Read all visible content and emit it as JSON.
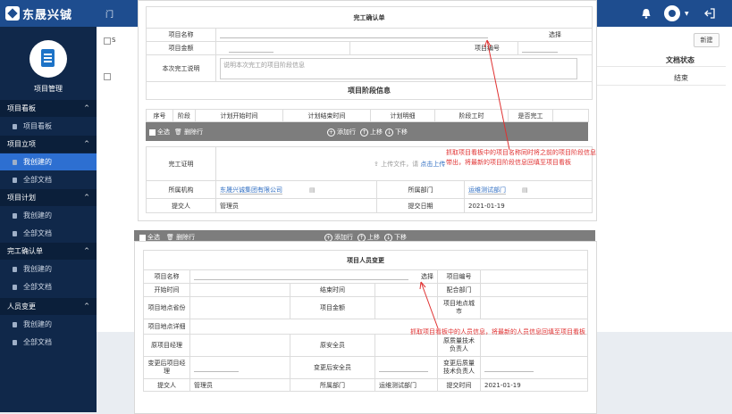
{
  "header": {
    "logo_text": "东晟兴铖",
    "left_fragment": "门",
    "icons": [
      "bell-icon",
      "user-avatar-icon",
      "logout-icon"
    ]
  },
  "sidebar": {
    "project_title": "项目管理",
    "sections": [
      {
        "label": "项目看板",
        "items": [
          "项目看板"
        ]
      },
      {
        "label": "项目立项",
        "items": [
          "我创建的",
          "全部文档"
        ]
      },
      {
        "label": "项目计划",
        "items": [
          "我创建的",
          "全部文档"
        ]
      },
      {
        "label": "完工确认单",
        "items": [
          "我创建的",
          "全部文档"
        ]
      },
      {
        "label": "人员变更",
        "items": [
          "我创建的",
          "全部文档"
        ]
      }
    ]
  },
  "list_bg": {
    "new_button": "新建",
    "col_status": "文档状态",
    "row_status": "结束",
    "left_fragment": "S"
  },
  "completion_form": {
    "title": "完工确认单",
    "project_name_label": "项目名称",
    "select_label": "选择",
    "project_amount_label": "项目金额",
    "project_number_label": "项目编号",
    "description_label": "本次完工说明",
    "description_placeholder": "说明本次完工的项目阶段信息",
    "stage_title": "项目阶段信息",
    "stage_columns": [
      "序号",
      "阶段",
      "计划开始时间",
      "计划结束时间",
      "计划明细",
      "阶段工时",
      "是否完工"
    ],
    "select_all": "全选",
    "delete_row": "删除行",
    "add_row": "添加行",
    "move_up": "上移",
    "move_down": "下移",
    "proof_label": "完工证明",
    "upload_text": "上传文件，请",
    "upload_link": "点击上传",
    "org_label": "所属机构",
    "org_value": "东晟兴诚集团有限公司",
    "dept_label": "所属部门",
    "dept_value": "运维测试部门",
    "submitter_label": "提交人",
    "submitter_value": "管理员",
    "submit_date_label": "提交日期",
    "submit_date_value": "2021-01-19"
  },
  "annotation1": [
    "抓取项目看板中的项目名称同时将之前的项目阶段信息",
    "带出，将最新的项目阶段信息回填至项目看板"
  ],
  "mid_toolbar": {
    "select_all": "全选",
    "delete_row": "删除行",
    "add_row": "添加行",
    "move_up": "上移",
    "move_down": "下移"
  },
  "staff_form": {
    "title": "项目人员变更",
    "project_name_label": "项目名称",
    "select_label": "选择",
    "project_number_label": "项目编号",
    "start_time_label": "开始时间",
    "end_time_label": "结束时间",
    "partner_dept_label": "配合部门",
    "province_label": "项目地点省份",
    "amount_label": "项目金额",
    "city_label": "项目地点城市",
    "address_label": "项目地点详细",
    "orig_manager_label": "原项目经理",
    "orig_safety_label": "原安全员",
    "orig_quality_label": "原质量技术负责人",
    "new_manager_label": "变更后项目经理",
    "new_safety_label": "变更后安全员",
    "new_quality_label": "变更后质量技术负责人",
    "submitter_label": "提交人",
    "submitter_value": "管理员",
    "dept_label": "所属部门",
    "dept_value": "运维测试部门",
    "submit_time_label": "提交时间",
    "submit_time_value": "2021-01-19"
  },
  "annotation2": "抓取项目看板中的人员信息，将最新的人员信息回填至项目看板",
  "colors": {
    "header": "#1e4d8f",
    "sidebar": "#10284a",
    "active": "#2d6fd1",
    "annotation": "#e03131"
  }
}
